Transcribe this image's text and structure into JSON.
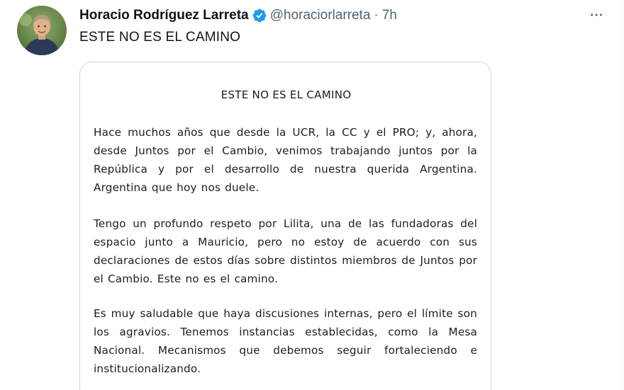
{
  "tweet": {
    "display_name": "Horacio Rodríguez Larreta",
    "handle": "@horaciorlarreta",
    "separator": "·",
    "time": "7h",
    "text": "ESTE NO ES EL CAMINO",
    "verified_icon": "verified-badge-icon",
    "more_icon": "more-options-icon",
    "colors": {
      "name": "#0f1419",
      "secondary": "#536471",
      "verified": "#1d9bf0",
      "card_border": "#cfd9de"
    }
  },
  "media": {
    "title": "ESTE NO ES EL CAMINO",
    "paragraphs": [
      "Hace muchos años que desde la UCR, la CC y el PRO; y, ahora, desde Juntos por el Cambio, venimos trabajando juntos por la República y por el desarrollo de nuestra querida Argentina. Argentina que hoy nos duele.",
      "Tengo un profundo respeto por Lilita, una de las fundadoras del espacio junto a Mauricio, pero no estoy de acuerdo con sus declaraciones de estos días sobre distintos miembros de Juntos por el Cambio. Este no es el camino.",
      "Es muy saludable que haya discusiones internas, pero el límite son los agravios. Tenemos instancias establecidas, como la Mesa Nacional. Mecanismos que debemos seguir fortaleciendo e institucionalizando."
    ]
  }
}
